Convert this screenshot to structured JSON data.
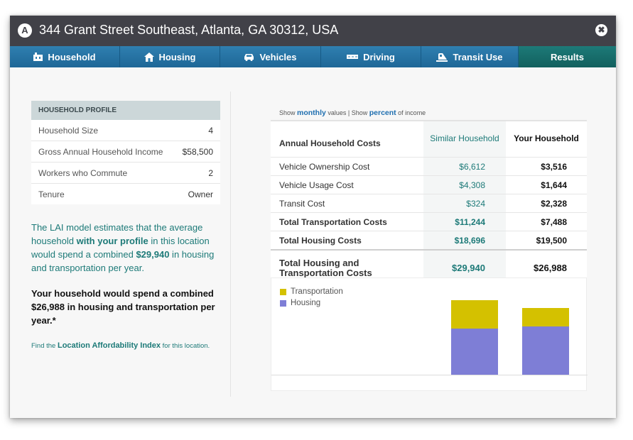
{
  "window": {
    "marker": "A",
    "title": "344 Grant Street Southeast, Atlanta, GA 30312, USA",
    "close_icon": "close-icon",
    "close_glyph": "✖"
  },
  "tabs": [
    {
      "label": "Household",
      "icon": "household-icon"
    },
    {
      "label": "Housing",
      "icon": "house-icon"
    },
    {
      "label": "Vehicles",
      "icon": "car-icon"
    },
    {
      "label": "Driving",
      "icon": "road-icon"
    },
    {
      "label": "Transit Use",
      "icon": "transit-icon"
    },
    {
      "label": "Results",
      "icon": "",
      "active": true
    }
  ],
  "profile": {
    "header": "HOUSEHOLD PROFILE",
    "rows": [
      {
        "label": "Household Size",
        "value": "4"
      },
      {
        "label": "Gross Annual Household Income",
        "value": "$58,500"
      },
      {
        "label": "Workers who Commute",
        "value": "2"
      },
      {
        "label": "Tenure",
        "value": "Owner"
      }
    ]
  },
  "estimate": {
    "part1": "The LAI model estimates that the average household ",
    "bold1": "with your profile",
    "part2": " in this location would spend a combined ",
    "bold2": "$29,940",
    "part3": " in housing and transportation per year."
  },
  "yours": "Your household would spend a combined $26,988 in housing and transportation per year.*",
  "find": {
    "prefix": "Find the ",
    "link": "Location Affordability Index",
    "suffix": " for this location."
  },
  "showline": {
    "show1": "Show ",
    "monthly": "monthly",
    "mid": " values | Show ",
    "percent": "percent",
    "suffix": " of income"
  },
  "costs": {
    "header": {
      "label": "Annual Household Costs",
      "similar": "Similar Household",
      "yours": "Your Household"
    },
    "rows": [
      {
        "label": "Vehicle Ownership Cost",
        "similar": "$6,612",
        "yours": "$3,516",
        "bold": false
      },
      {
        "label": "Vehicle Usage Cost",
        "similar": "$4,308",
        "yours": "$1,644",
        "bold": false
      },
      {
        "label": "Transit Cost",
        "similar": "$324",
        "yours": "$2,328",
        "bold": false
      },
      {
        "label": "Total Transportation Costs",
        "similar": "$11,244",
        "yours": "$7,488",
        "bold": true
      },
      {
        "label": "Total Housing Costs",
        "similar": "$18,696",
        "yours": "$19,500",
        "bold": true
      }
    ],
    "total": {
      "label": "Total Housing and Transportation Costs",
      "similar": "$29,940",
      "yours": "$26,988"
    }
  },
  "chart_data": {
    "type": "bar",
    "stacked": true,
    "categories": [
      "Similar Household",
      "Your Household"
    ],
    "series": [
      {
        "name": "Transportation",
        "values": [
          11244,
          7488
        ],
        "color": "#d4c100"
      },
      {
        "name": "Housing",
        "values": [
          18696,
          19500
        ],
        "color": "#7e7ed6"
      }
    ],
    "ylim": [
      0,
      40000
    ],
    "legend": "top-left"
  }
}
